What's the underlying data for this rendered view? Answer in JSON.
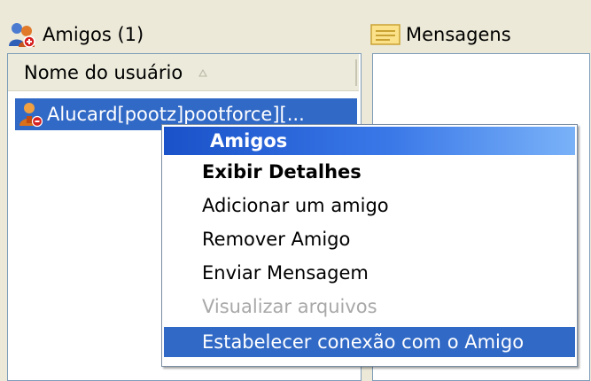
{
  "friends_panel": {
    "title": "Amigos (1)",
    "title_icon": "friends-icon",
    "column_header": "Nome do usuário",
    "sort_icon": "sort-ascending-icon",
    "items": [
      {
        "username": "Alucard[pootz]pootforce][...",
        "icon": "user-icon",
        "selected": true
      }
    ]
  },
  "messages_panel": {
    "title": "Mensagens",
    "title_icon": "messages-icon"
  },
  "context_menu": {
    "title": "Amigos",
    "items": [
      {
        "label": "Exibir Detalhes",
        "bold": true,
        "disabled": false,
        "highlighted": false
      },
      {
        "label": "Adicionar um amigo",
        "bold": false,
        "disabled": false,
        "highlighted": false
      },
      {
        "label": "Remover Amigo",
        "bold": false,
        "disabled": false,
        "highlighted": false
      },
      {
        "label": "Enviar Mensagem",
        "bold": false,
        "disabled": false,
        "highlighted": false
      },
      {
        "label": "Visualizar arquivos",
        "bold": false,
        "disabled": true,
        "highlighted": false
      },
      {
        "label": "Estabelecer conexão com o Amigo",
        "bold": false,
        "disabled": false,
        "highlighted": true
      }
    ]
  },
  "colors": {
    "window_bg": "#ece9d8",
    "selection": "#3169c6",
    "menu_title_gradient_start": "#1a52c9",
    "menu_title_gradient_end": "#7ab2f8",
    "disabled_text": "#a8a8a8"
  }
}
